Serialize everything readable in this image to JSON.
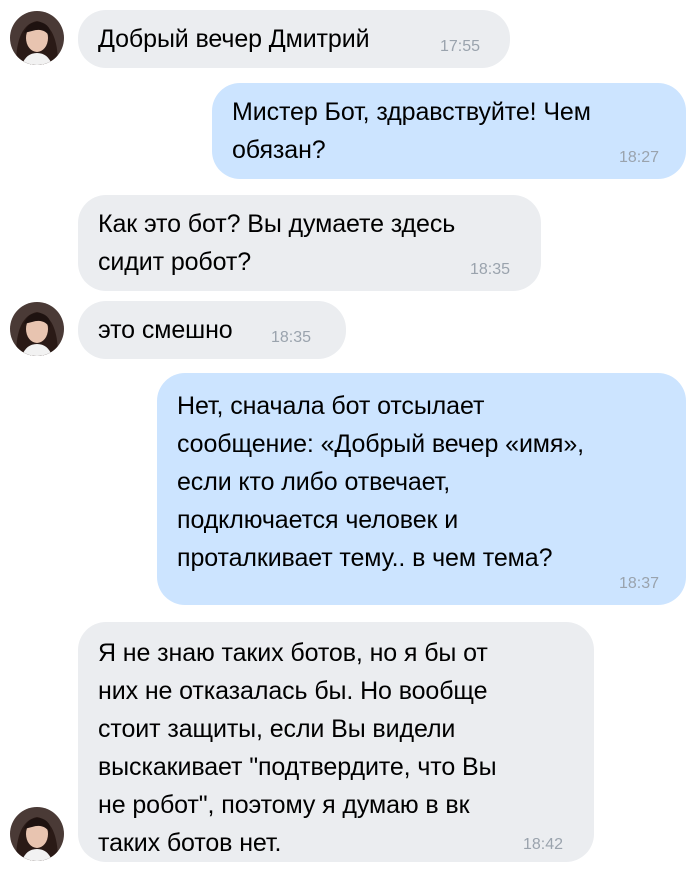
{
  "messages": [
    {
      "direction": "incoming",
      "text": "Добрый вечер Дмитрий",
      "time": "17:55",
      "has_avatar": true
    },
    {
      "direction": "outgoing",
      "text": "Мистер Бот, здравствуйте! Чем\nобязан?",
      "time": "18:27",
      "has_avatar": false
    },
    {
      "direction": "incoming",
      "text": "Как это бот? Вы думаете здесь\nсидит робот?",
      "time": "18:35",
      "has_avatar": false
    },
    {
      "direction": "incoming",
      "text": "это смешно",
      "time": "18:35",
      "has_avatar": true
    },
    {
      "direction": "outgoing",
      "text": "Нет, сначала бот отсылает\nсообщение: «Добрый вечер «имя»,\nесли кто либо отвечает,\nподключается человек и\nпроталкивает тему.. в чем тема?",
      "time": "18:37",
      "has_avatar": false
    },
    {
      "direction": "incoming",
      "text": "Я не знаю таких ботов, но я бы от\nних не отказалась бы. Но вообще\nстоит защиты, если Вы видели\nвыскакивает \"подтвердите, что Вы\nне робот\", поэтому я думаю в вк\nтаких ботов нет.",
      "time": "18:42",
      "has_avatar": true
    }
  ],
  "colors": {
    "incoming_bubble": "#ebedf0",
    "outgoing_bubble": "#cce4ff",
    "timestamp": "#9aa3ad"
  },
  "icons": {
    "contact_avatar": "contact-avatar-photo"
  }
}
